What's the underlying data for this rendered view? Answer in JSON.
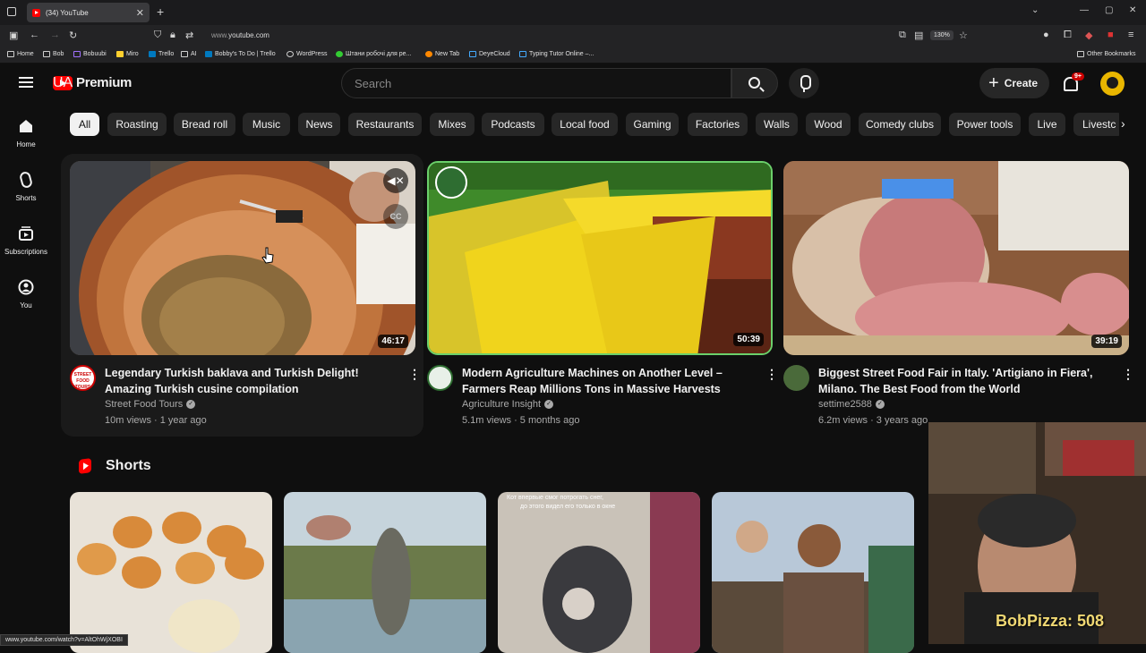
{
  "browser": {
    "tab_title": "(34) YouTube",
    "url_prefix": "www.",
    "url_domain": "youtube.com",
    "zoom": "130%"
  },
  "bookmarks": [
    "Home",
    "Bob",
    "Bobuubi",
    "Miro",
    "Trello",
    "AI",
    "Bobby's To Do | Trello",
    "WordPress",
    "Штани робочі для ре...",
    "New Tab",
    "DeyeCloud",
    "Typing Tutor Online –...",
    "Other Bookmarks"
  ],
  "header": {
    "logo_text": "Premium",
    "region": "UA",
    "search_placeholder": "Search",
    "create_label": "Create",
    "notification_count": "9+"
  },
  "sidenav": [
    {
      "label": "Home",
      "icon": "home-icon"
    },
    {
      "label": "Shorts",
      "icon": "shorts-icon"
    },
    {
      "label": "Subscriptions",
      "icon": "subscriptions-icon"
    },
    {
      "label": "You",
      "icon": "you-icon"
    }
  ],
  "chips": [
    "All",
    "Roasting",
    "Bread roll",
    "Music",
    "News",
    "Restaurants",
    "Mixes",
    "Podcasts",
    "Local food",
    "Gaming",
    "Factories",
    "Walls",
    "Wood",
    "Comedy clubs",
    "Power tools",
    "Live",
    "Livestc"
  ],
  "videos": [
    {
      "title": "Legendary Turkish baklava and Turkish Delight! Amazing Turkish cusine compilation",
      "channel": "Street Food Tours",
      "meta": "10m views · 1 year ago",
      "duration": "46:17"
    },
    {
      "title": "Modern Agriculture Machines on Another Level – Farmers Reap Millions Tons in Massive Harvests",
      "channel": "Agriculture Insight",
      "meta": "5.1m views · 5 months ago",
      "duration": "50:39"
    },
    {
      "title": "Biggest Street Food Fair in Italy. 'Artigiano in Fiera', Milano. The Best Food from the World",
      "channel": "settime2588",
      "meta": "6.2m views · 3 years ago",
      "duration": "39:19"
    }
  ],
  "shorts_heading": "Shorts",
  "webcam_overlay": "BobPizza: 508",
  "status_url": "www.youtube.com/watch?v=AltOhWjXOBI"
}
